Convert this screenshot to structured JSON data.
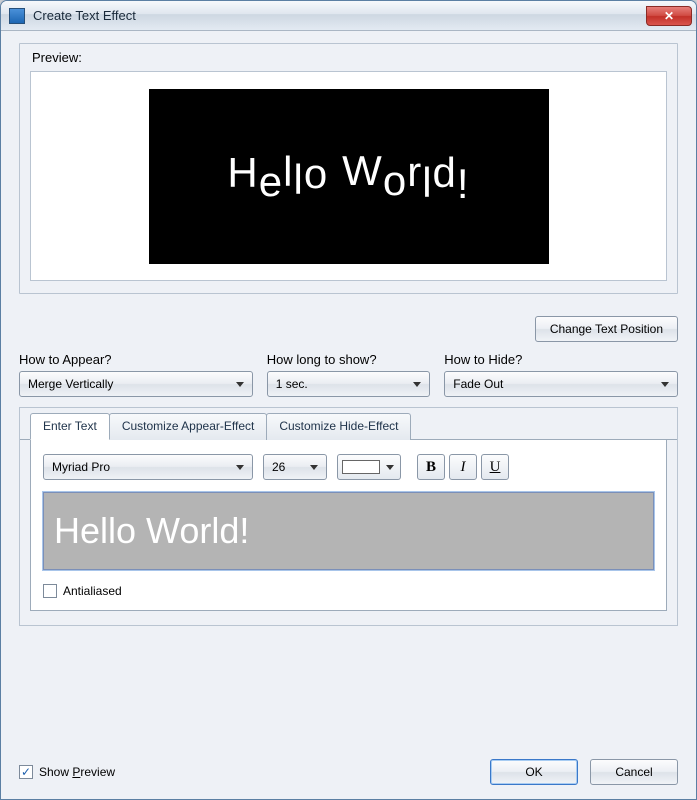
{
  "window": {
    "title": "Create Text Effect"
  },
  "preview": {
    "label": "Preview:",
    "text": "Hello World!"
  },
  "buttons": {
    "change_position": "Change Text Position",
    "ok": "OK",
    "cancel": "Cancel"
  },
  "appear": {
    "label": "How to Appear?",
    "value": "Merge Vertically"
  },
  "duration": {
    "label": "How long to show?",
    "value": "1 sec."
  },
  "hide": {
    "label": "How to Hide?",
    "value": "Fade Out"
  },
  "tabs": {
    "enter": "Enter Text",
    "appear": "Customize Appear-Effect",
    "hide": "Customize Hide-Effect"
  },
  "font": {
    "name": "Myriad Pro",
    "size": "26"
  },
  "style": {
    "bold": "B",
    "italic": "I",
    "underline": "U"
  },
  "text_input": {
    "value": "Hello World!"
  },
  "antialias": {
    "label": "Antialiased",
    "checked": false
  },
  "show_preview": {
    "label": "Show Preview",
    "checked": true
  }
}
